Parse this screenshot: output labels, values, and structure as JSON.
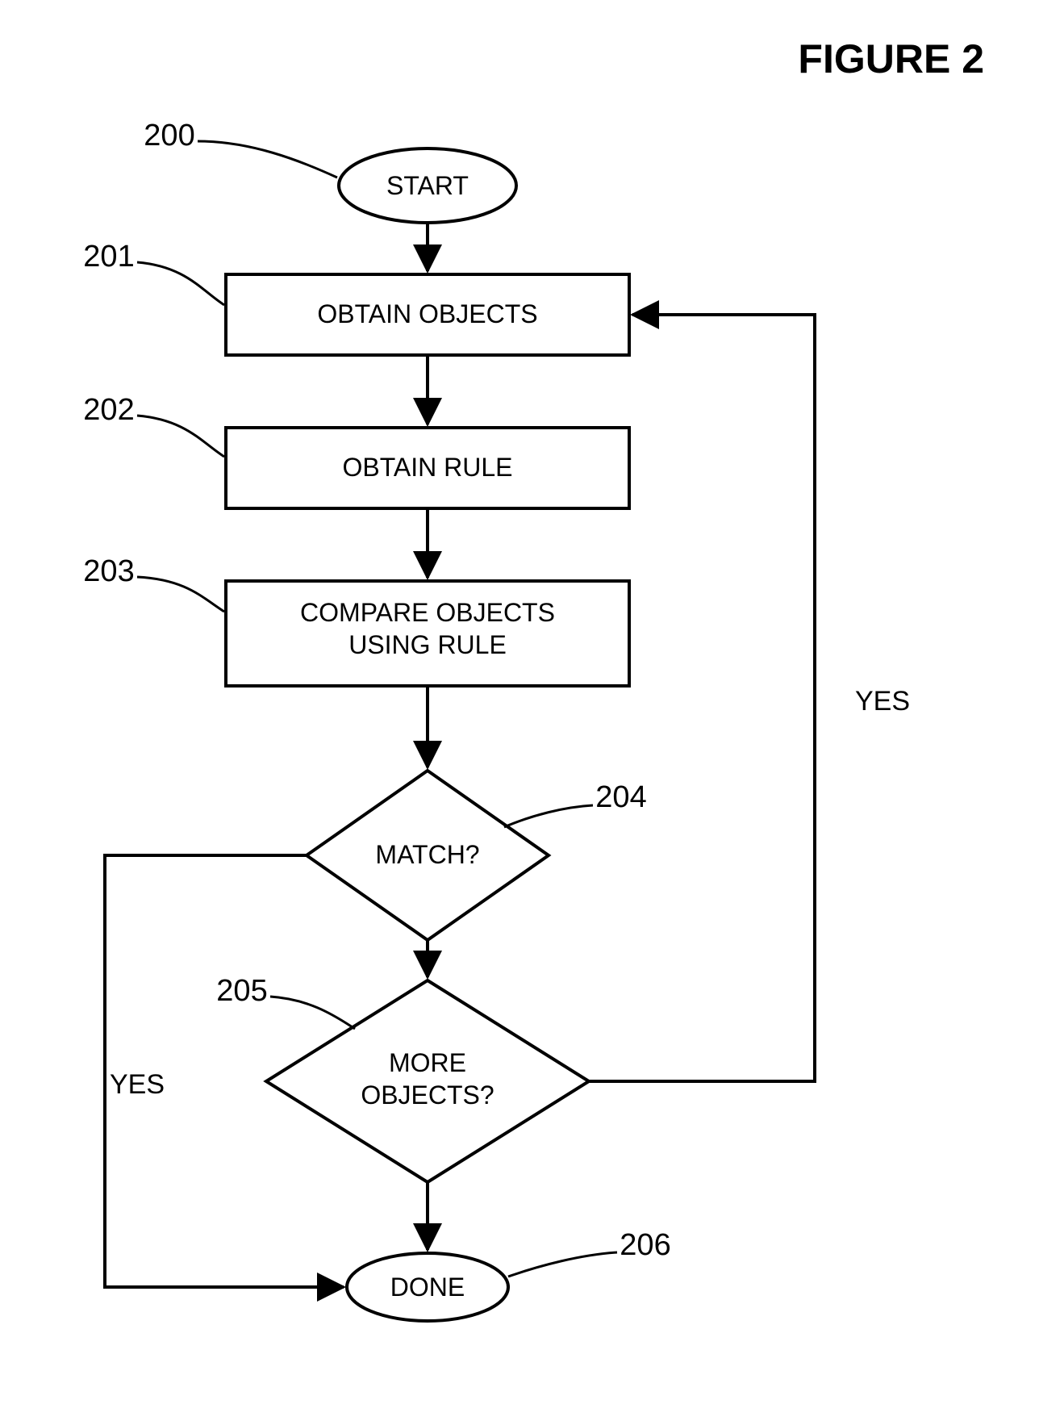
{
  "title": "FIGURE 2",
  "refs": {
    "r200": "200",
    "r201": "201",
    "r202": "202",
    "r203": "203",
    "r204": "204",
    "r205": "205",
    "r206": "206"
  },
  "nodes": {
    "start": "START",
    "obtain_objects": "OBTAIN OBJECTS",
    "obtain_rule": "OBTAIN RULE",
    "compare_l1": "COMPARE OBJECTS",
    "compare_l2": "USING RULE",
    "match": "MATCH?",
    "more_l1": "MORE",
    "more_l2": "OBJECTS?",
    "done": "DONE"
  },
  "edges": {
    "yes_loop": "YES",
    "yes_match": "YES"
  }
}
